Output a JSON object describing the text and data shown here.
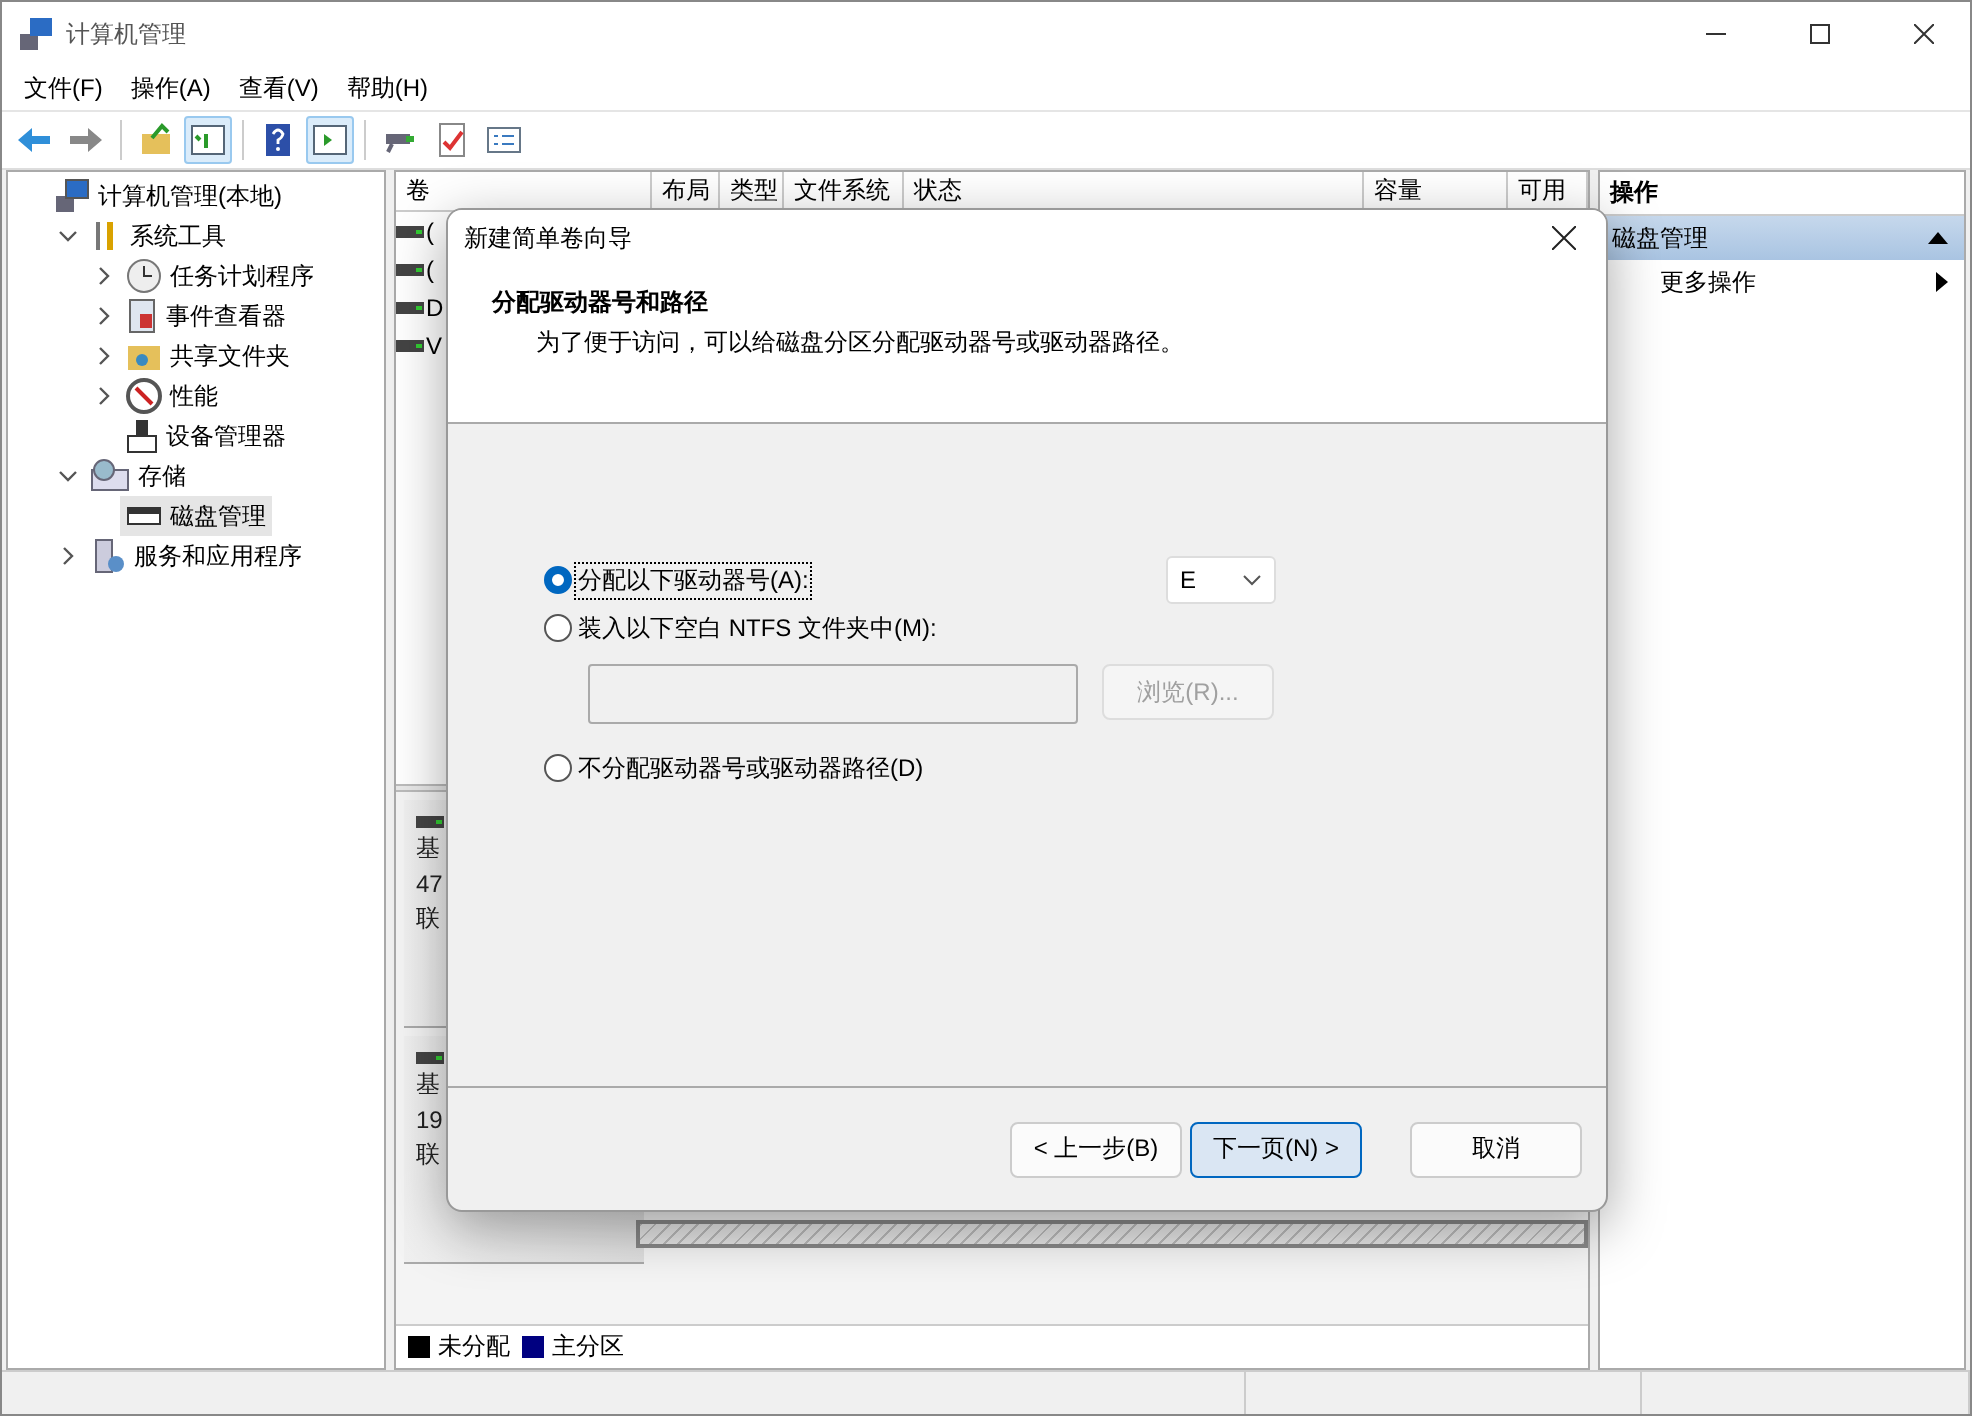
{
  "window": {
    "title": "计算机管理"
  },
  "menu": [
    {
      "label": "文件(F)"
    },
    {
      "label": "操作(A)"
    },
    {
      "label": "查看(V)"
    },
    {
      "label": "帮助(H)"
    }
  ],
  "toolbar": [
    {
      "kind": "back",
      "pressed": false
    },
    {
      "kind": "forward",
      "pressed": false
    },
    {
      "kind": "separator"
    },
    {
      "kind": "up",
      "pressed": false
    },
    {
      "kind": "tree-pane",
      "pressed": true
    },
    {
      "kind": "separator"
    },
    {
      "kind": "help",
      "pressed": false
    },
    {
      "kind": "action-pane",
      "pressed": true
    },
    {
      "kind": "separator"
    },
    {
      "kind": "connect",
      "pressed": false
    },
    {
      "kind": "check",
      "pressed": false
    },
    {
      "kind": "properties",
      "pressed": false
    }
  ],
  "tree": [
    {
      "label": "计算机管理(本地)",
      "selected": false,
      "children": [
        {
          "label": "系统工具",
          "expanded": true,
          "selected": false,
          "children": [
            {
              "label": "任务计划程序",
              "expanded": false,
              "selected": false
            },
            {
              "label": "事件查看器",
              "expanded": false,
              "selected": false
            },
            {
              "label": "共享文件夹",
              "expanded": false,
              "selected": false
            },
            {
              "label": "性能",
              "expanded": false,
              "selected": false
            },
            {
              "label": "设备管理器",
              "selected": false
            }
          ]
        },
        {
          "label": "存储",
          "expanded": true,
          "selected": false,
          "children": [
            {
              "label": "磁盘管理",
              "selected": true
            }
          ]
        },
        {
          "label": "服务和应用程序",
          "expanded": false,
          "selected": false
        }
      ]
    }
  ],
  "table": {
    "columns": [
      "卷",
      "布局",
      "类型",
      "文件系统",
      "状态",
      "容量",
      "可用"
    ],
    "rows": [
      {
        "name": "("
      },
      {
        "name": "("
      },
      {
        "name": "D"
      },
      {
        "name": "V"
      }
    ]
  },
  "disks": [
    {
      "lines": [
        "基",
        "47",
        "联"
      ]
    },
    {
      "lines": [
        "基",
        "19",
        "联"
      ]
    }
  ],
  "legend": [
    {
      "label": "未分配",
      "color": "#000000"
    },
    {
      "label": "主分区",
      "color": "#000080"
    }
  ],
  "actions": {
    "title": "操作",
    "section": {
      "label": "磁盘管理",
      "expanded": true
    },
    "items": [
      {
        "label": "更多操作"
      }
    ]
  },
  "dialog": {
    "title": "新建简单卷向导",
    "heading": "分配驱动器号和路径",
    "description": "为了便于访问，可以给磁盘分区分配驱动器号或驱动器路径。",
    "options": [
      {
        "label": "分配以下驱动器号(A):",
        "selected": true,
        "focused": true
      },
      {
        "label": "装入以下空白 NTFS 文件夹中(M):",
        "selected": false,
        "focused": false
      },
      {
        "label": "不分配驱动器号或驱动器路径(D)",
        "selected": false,
        "focused": false
      }
    ],
    "drive_letter": {
      "value": "E"
    },
    "folder_path": {
      "disabled": true
    },
    "browse": {
      "label": "浏览(R)...",
      "disabled": true
    },
    "buttons": [
      {
        "label": "< 上一步(B)",
        "default": false
      },
      {
        "label": "下一页(N) >",
        "default": true
      },
      {
        "label": "取消",
        "default": false
      }
    ]
  }
}
